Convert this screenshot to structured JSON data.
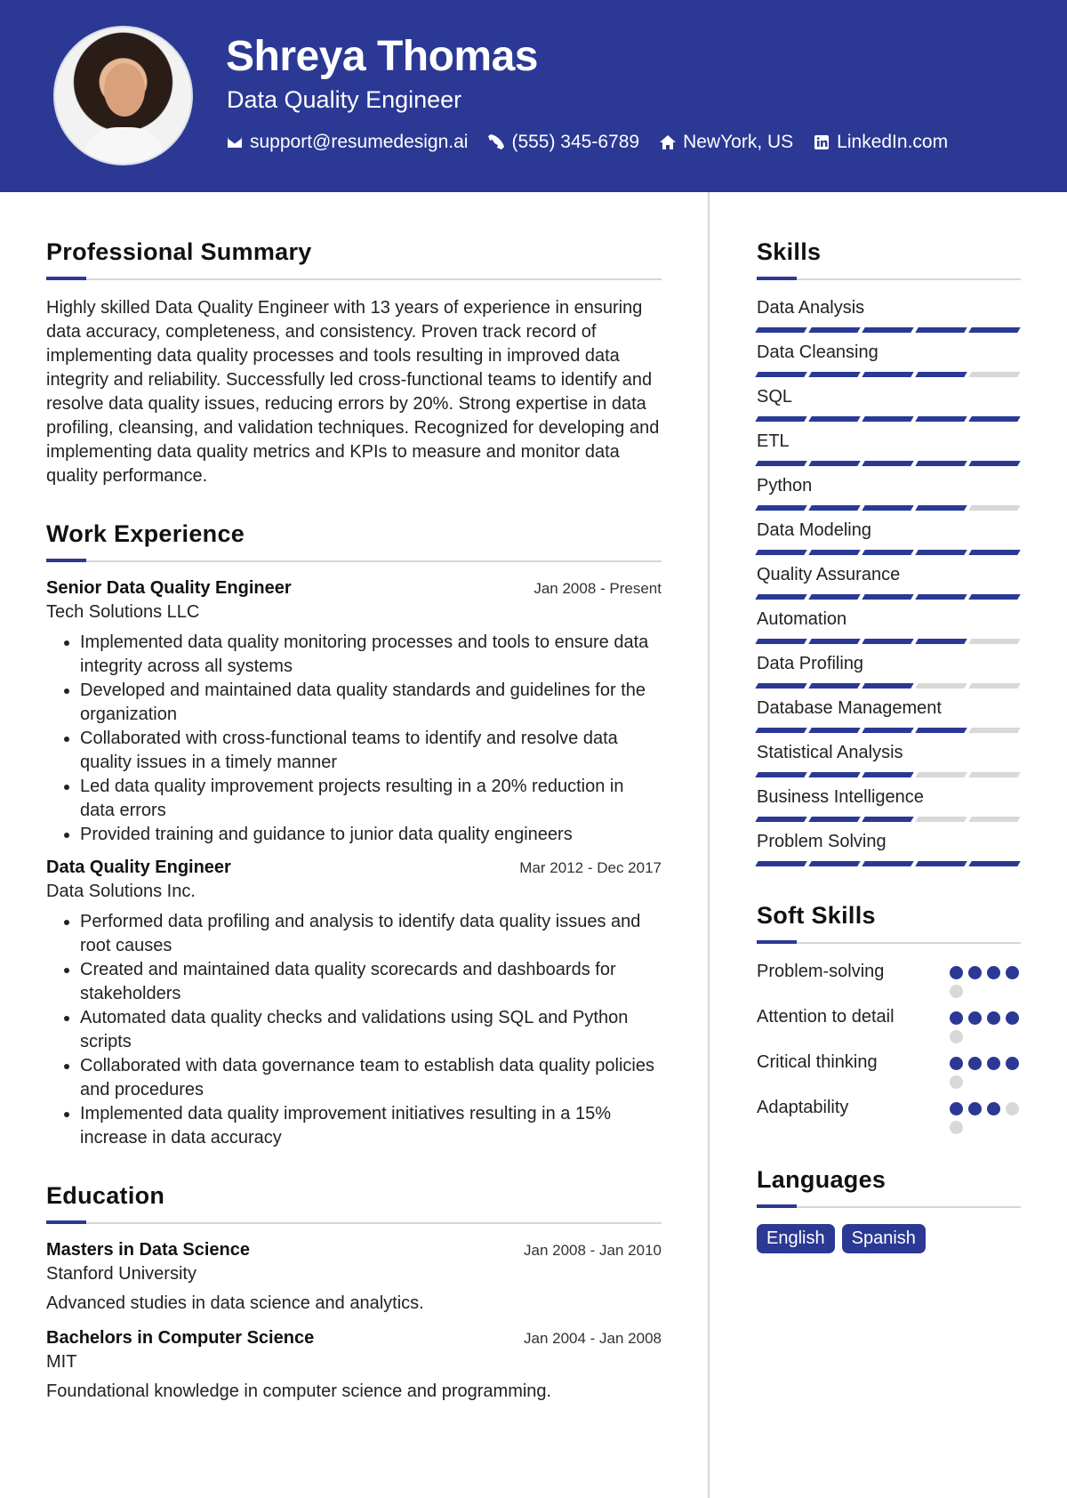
{
  "header": {
    "name": "Shreya Thomas",
    "title": "Data Quality Engineer",
    "contacts": [
      {
        "icon": "envelope-icon",
        "text": "support@resumedesign.ai"
      },
      {
        "icon": "phone-icon",
        "text": "(555) 345-6789"
      },
      {
        "icon": "home-icon",
        "text": "NewYork, US"
      },
      {
        "icon": "linkedin-icon",
        "text": "LinkedIn.com"
      }
    ]
  },
  "summary": {
    "heading": "Professional Summary",
    "text": "Highly skilled Data Quality Engineer with 13 years of experience in ensuring data accuracy, completeness, and consistency. Proven track record of implementing data quality processes and tools resulting in improved data integrity and reliability. Successfully led cross-functional teams to identify and resolve data quality issues, reducing errors by 20%. Strong expertise in data profiling, cleansing, and validation techniques. Recognized for developing and implementing data quality metrics and KPIs to measure and monitor data quality performance."
  },
  "experience": {
    "heading": "Work Experience",
    "jobs": [
      {
        "title": "Senior Data Quality Engineer",
        "date": "Jan 2008 - Present",
        "org": "Tech Solutions LLC",
        "bullets": [
          "Implemented data quality monitoring processes and tools to ensure data integrity across all systems",
          "Developed and maintained data quality standards and guidelines for the organization",
          "Collaborated with cross-functional teams to identify and resolve data quality issues in a timely manner",
          "Led data quality improvement projects resulting in a 20% reduction in data errors",
          "Provided training and guidance to junior data quality engineers"
        ]
      },
      {
        "title": "Data Quality Engineer",
        "date": "Mar 2012 - Dec 2017",
        "org": "Data Solutions Inc.",
        "bullets": [
          "Performed data profiling and analysis to identify data quality issues and root causes",
          "Created and maintained data quality scorecards and dashboards for stakeholders",
          "Automated data quality checks and validations using SQL and Python scripts",
          "Collaborated with data governance team to establish data quality policies and procedures",
          "Implemented data quality improvement initiatives resulting in a 15% increase in data accuracy"
        ]
      }
    ]
  },
  "education": {
    "heading": "Education",
    "items": [
      {
        "degree": "Masters in Data Science",
        "date": "Jan 2008 - Jan 2010",
        "school": "Stanford University",
        "desc": "Advanced studies in data science and analytics."
      },
      {
        "degree": "Bachelors in Computer Science",
        "date": "Jan 2004 - Jan 2008",
        "school": "MIT",
        "desc": "Foundational knowledge in computer science and programming."
      }
    ]
  },
  "skills": {
    "heading": "Skills",
    "max": 5,
    "items": [
      {
        "name": "Data Analysis",
        "level": 5
      },
      {
        "name": "Data Cleansing",
        "level": 4
      },
      {
        "name": "SQL",
        "level": 5
      },
      {
        "name": "ETL",
        "level": 5
      },
      {
        "name": "Python",
        "level": 4
      },
      {
        "name": "Data Modeling",
        "level": 5
      },
      {
        "name": "Quality Assurance",
        "level": 5
      },
      {
        "name": "Automation",
        "level": 4
      },
      {
        "name": "Data Profiling",
        "level": 3
      },
      {
        "name": "Database Management",
        "level": 4
      },
      {
        "name": "Statistical Analysis",
        "level": 3
      },
      {
        "name": "Business Intelligence",
        "level": 3
      },
      {
        "name": "Problem Solving",
        "level": 5
      }
    ]
  },
  "soft_skills": {
    "heading": "Soft Skills",
    "max": 5,
    "items": [
      {
        "name": "Problem-solving",
        "level": 4
      },
      {
        "name": "Attention to detail",
        "level": 4
      },
      {
        "name": "Critical thinking",
        "level": 4
      },
      {
        "name": "Adaptability",
        "level": 3
      }
    ]
  },
  "languages": {
    "heading": "Languages",
    "items": [
      "English",
      "Spanish"
    ]
  },
  "colors": {
    "accent": "#2b3994",
    "inactive": "#d8d8d8"
  }
}
